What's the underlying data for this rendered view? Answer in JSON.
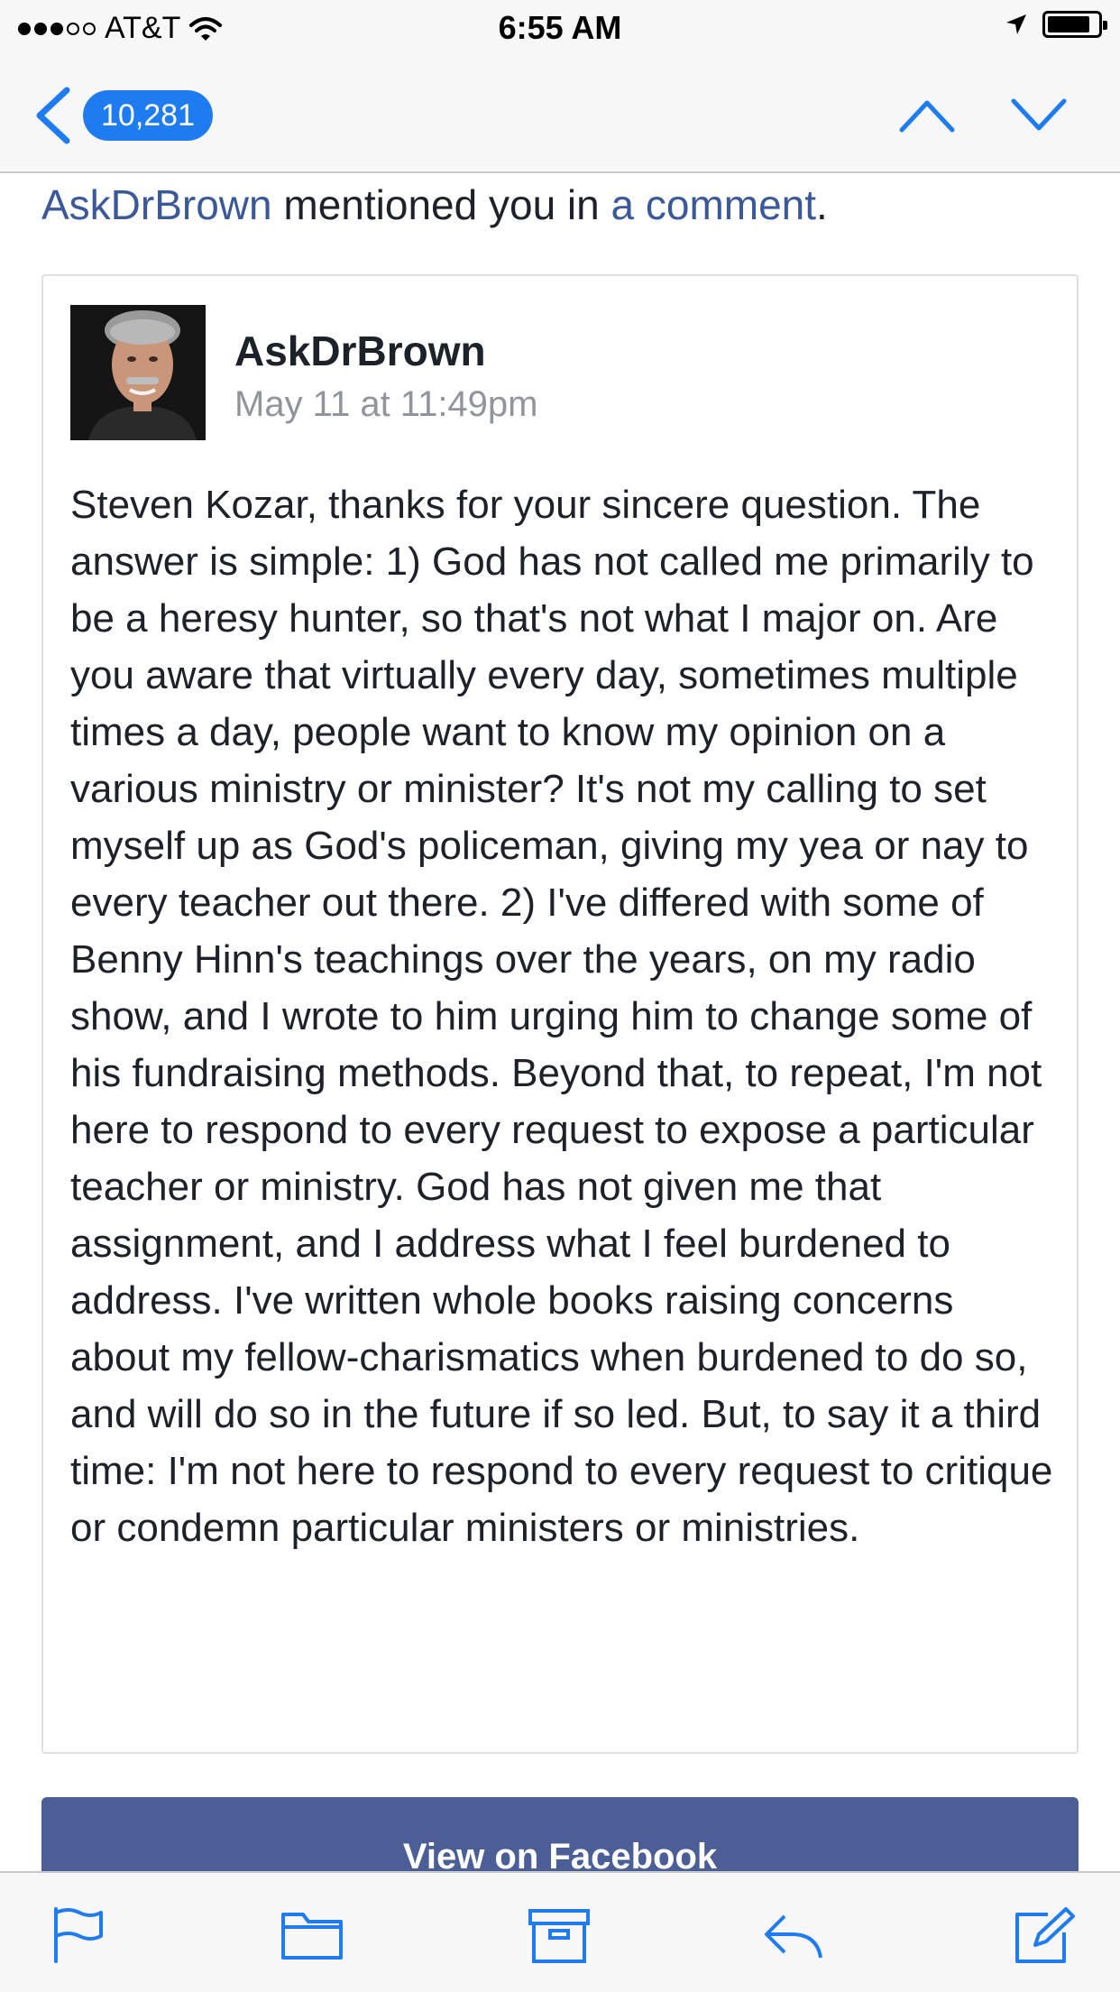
{
  "status_bar": {
    "carrier": "AT&T",
    "time": "6:55 AM",
    "signal_bars_filled": 3,
    "signal_bars_total": 5
  },
  "nav": {
    "message_count": "10,281"
  },
  "email": {
    "mention_author": "AskDrBrown",
    "mention_middle": " mentioned you in ",
    "mention_link": "a comment",
    "mention_end": ".",
    "card": {
      "author": "AskDrBrown",
      "date": "May 11 at 11:49pm",
      "comment": "Steven Kozar, thanks for your sincere question. The answer is simple: 1) God has not called me primarily to be a heresy hunter, so that's not what I major on. Are you aware that virtually every day, sometimes multiple times a day, people want to know my opinion on a various ministry or minister? It's not my calling to set myself up as God's policeman, giving my yea or nay to every teacher out there. 2) I've differed with some of Benny Hinn's teachings over the years, on my radio show, and I wrote to him urging him to change some of his fundraising methods. Beyond that, to repeat, I'm not here to respond to every request to expose a particular teacher or ministry. God has not given me that assignment, and I address what I feel burdened to address. I've written whole books raising concerns about my fellow-charismatics when burdened to do so, and will do so in the future if so led. But, to say it a third time: I'm not here to respond to every request to critique or condemn particular ministers or ministries."
    },
    "button_label": "View on Facebook"
  },
  "icons": {
    "back": "chevron-left-icon",
    "up": "chevron-up-icon",
    "down": "chevron-down-icon",
    "flag": "flag-icon",
    "folder": "folder-icon",
    "archive": "archive-icon",
    "reply": "reply-icon",
    "compose": "compose-icon"
  },
  "colors": {
    "ios_blue": "#1f7cf0",
    "facebook_link": "#3b5998",
    "facebook_button": "#4b5f96",
    "muted_text": "#90949c"
  }
}
